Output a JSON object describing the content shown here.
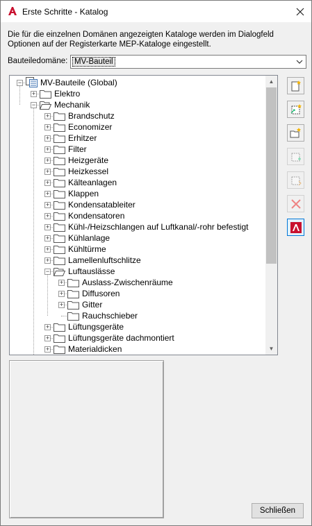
{
  "window": {
    "title": "Erste Schritte - Katalog",
    "accent_color": "#c8102e"
  },
  "description": "Die für die einzelnen Domänen angezeigten Kataloge werden im Dialogfeld Optionen auf der Registerkarte MEP-Kataloge eingestellt.",
  "domain": {
    "label": "Bauteiledomäne:",
    "value": "MV-Bauteil"
  },
  "tree": {
    "root": "MV-Bauteile (Global)",
    "elektro": "Elektro",
    "mechanik": "Mechanik",
    "mechanik_children": [
      "Brandschutz",
      "Economizer",
      "Erhitzer",
      "Filter",
      "Heizgeräte",
      "Heizkessel",
      "Kälteanlagen",
      "Klappen",
      "Kondensatableiter",
      "Kondensatoren",
      "Kühl-/Heizschlangen auf Luftkanal/-rohr befestigt",
      "Kühlanlage",
      "Kühltürme",
      "Lamellenluftschlitze",
      "Luftauslässe"
    ],
    "luftauslaesse_children": [
      "Auslass-Zwischenräume",
      "Diffusoren",
      "Gitter",
      "Rauchschieber"
    ],
    "after_children": [
      "Lüftungsgeräte",
      "Lüftungsgeräte dachmontiert",
      "Materialdicken"
    ]
  },
  "toolbar": {
    "icons": [
      "new-catalog-icon",
      "new-chapter-icon",
      "open-catalog-icon",
      "add-part-icon",
      "copy-part-icon",
      "delete-icon",
      "autocad-icon"
    ]
  },
  "buttons": {
    "close_label": "Schließen"
  }
}
